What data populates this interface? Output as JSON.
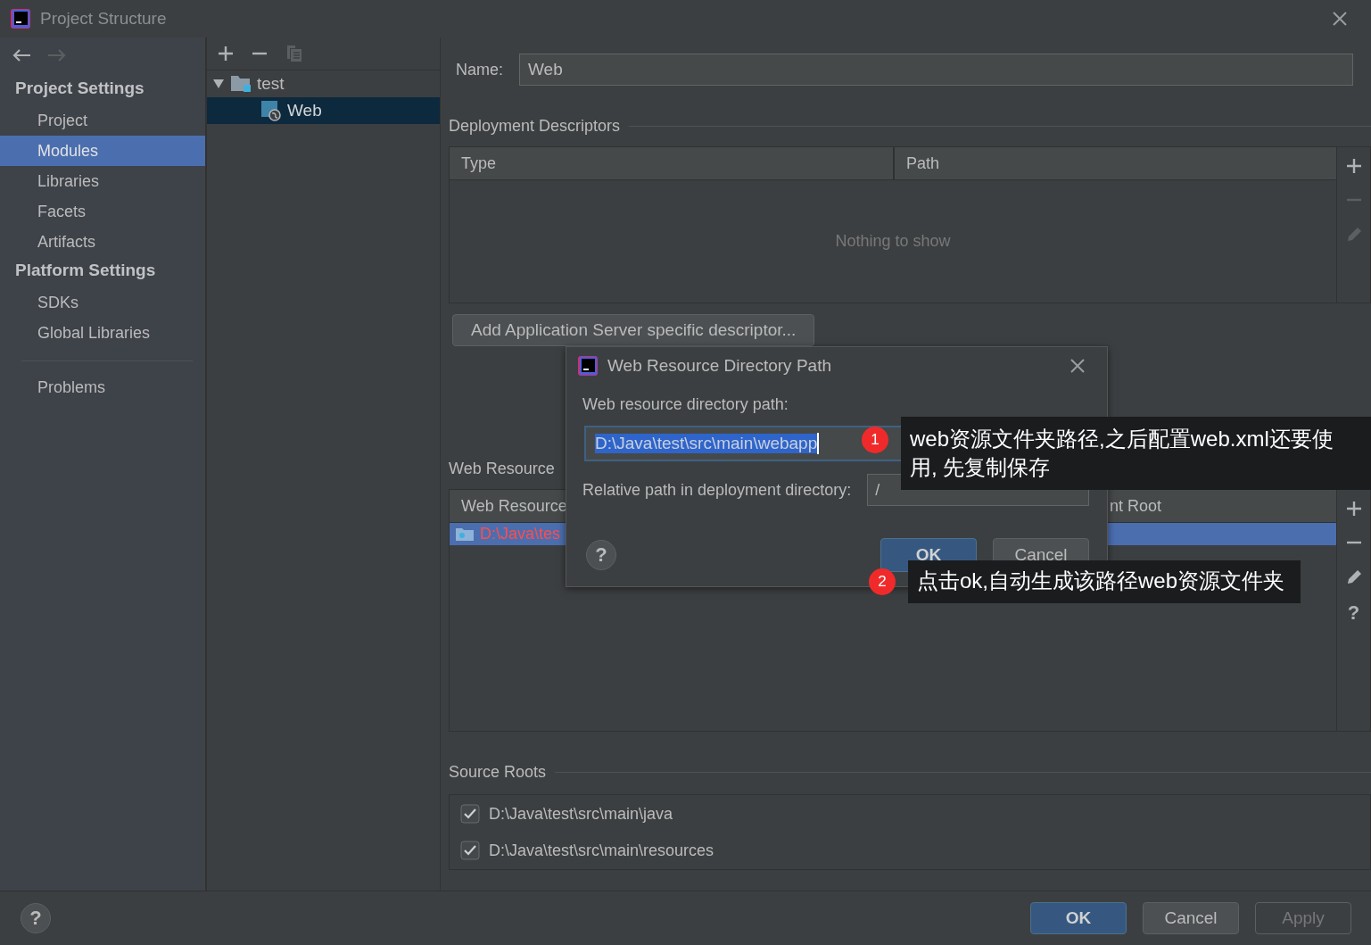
{
  "window": {
    "title": "Project Structure"
  },
  "sidebar": {
    "sections": [
      {
        "title": "Project Settings",
        "items": [
          {
            "label": "Project",
            "selected": false
          },
          {
            "label": "Modules",
            "selected": true
          },
          {
            "label": "Libraries",
            "selected": false
          },
          {
            "label": "Facets",
            "selected": false
          },
          {
            "label": "Artifacts",
            "selected": false
          }
        ]
      },
      {
        "title": "Platform Settings",
        "items": [
          {
            "label": "SDKs",
            "selected": false
          },
          {
            "label": "Global Libraries",
            "selected": false
          }
        ]
      }
    ],
    "extra_items": [
      {
        "label": "Problems",
        "selected": false
      }
    ]
  },
  "tree": [
    {
      "label": "test",
      "expanded": true,
      "selected": false,
      "children": [
        {
          "label": "Web",
          "selected": true
        }
      ]
    }
  ],
  "module": {
    "name_label": "Name:",
    "name_value": "Web"
  },
  "deployment_descriptors": {
    "title": "Deployment Descriptors",
    "columns": [
      "Type",
      "Path"
    ],
    "empty_text": "Nothing to show",
    "add_button": "Add Application Server specific descriptor...",
    "tools": [
      {
        "kind": "add",
        "disabled": false
      },
      {
        "kind": "remove",
        "disabled": true
      },
      {
        "kind": "edit",
        "disabled": true
      }
    ]
  },
  "web_resource_directories": {
    "title": "Web Resource",
    "columns": [
      "Web Resource",
      "nt Root"
    ],
    "rows": [
      {
        "path": "D:\\Java\\tes",
        "selected": true
      }
    ],
    "tools": [
      {
        "kind": "add",
        "disabled": false
      },
      {
        "kind": "remove",
        "disabled": false
      },
      {
        "kind": "edit",
        "disabled": false
      },
      {
        "kind": "help",
        "label": "?",
        "disabled": false
      }
    ]
  },
  "source_roots": {
    "title": "Source Roots",
    "items": [
      {
        "path": "D:\\Java\\test\\src\\main\\java",
        "checked": true
      },
      {
        "path": "D:\\Java\\test\\src\\main\\resources",
        "checked": true
      }
    ]
  },
  "help_button": "?",
  "buttons": [
    {
      "label": "OK",
      "kind": "primary",
      "disabled": false
    },
    {
      "label": "Cancel",
      "kind": "normal",
      "disabled": false
    },
    {
      "label": "Apply",
      "kind": "normal",
      "disabled": true
    }
  ],
  "dialog": {
    "title": "Web Resource Directory Path",
    "path_label": "Web resource directory path:",
    "path_value": "D:\\Java\\test\\src\\main\\webapp",
    "relative_label": "Relative path in deployment directory:",
    "relative_value": "/",
    "help_button": "?",
    "buttons": [
      {
        "label": "OK",
        "kind": "primary",
        "disabled": false
      },
      {
        "label": "Cancel",
        "kind": "normal",
        "disabled": false
      }
    ]
  },
  "annotations": [
    {
      "number": "1",
      "text": "web资源文件夹路径,之后配置web.xml还要使用, 先复制保存"
    },
    {
      "number": "2",
      "text": "点击ok,自动生成该路径web资源文件夹"
    }
  ]
}
